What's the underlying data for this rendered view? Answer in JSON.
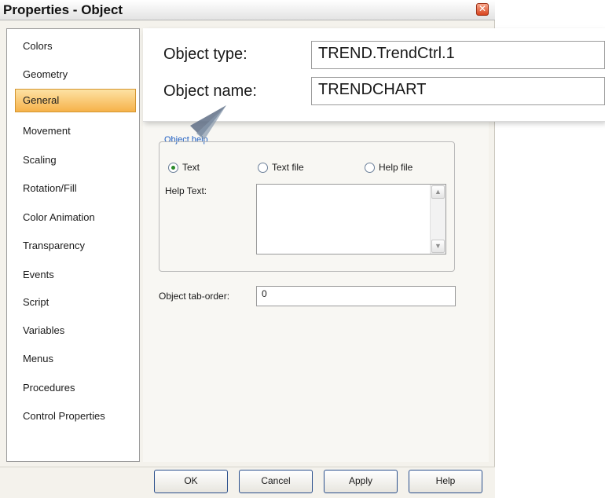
{
  "window": {
    "title": "Properties - Object",
    "close_glyph": "✕"
  },
  "sidebar": {
    "items": [
      {
        "label": "Colors"
      },
      {
        "label": "Geometry"
      },
      {
        "label": "General",
        "active": true
      },
      {
        "label": "Movement"
      },
      {
        "label": "Scaling"
      },
      {
        "label": "Rotation/Fill"
      },
      {
        "label": "Color Animation"
      },
      {
        "label": "Transparency"
      },
      {
        "label": "Events"
      },
      {
        "label": "Script"
      },
      {
        "label": "Variables"
      },
      {
        "label": "Menus"
      },
      {
        "label": "Procedures"
      },
      {
        "label": "Control Properties"
      }
    ]
  },
  "callout": {
    "object_type_label": "Object type:",
    "object_type_value": "TREND.TrendCtrl.1",
    "object_name_label": "Object name:",
    "object_name_value": "TRENDCHART"
  },
  "object_help": {
    "legend": "Object help",
    "radios": [
      {
        "label": "Text",
        "checked": true
      },
      {
        "label": "Text file",
        "checked": false
      },
      {
        "label": "Help file",
        "checked": false
      }
    ],
    "help_text_label": "Help Text:",
    "help_text_value": ""
  },
  "tab_order": {
    "label": "Object tab-order:",
    "value": "0"
  },
  "buttons": {
    "ok": "OK",
    "cancel": "Cancel",
    "apply": "Apply",
    "help": "Help"
  },
  "colors": {
    "active_item": "#f6b24a",
    "legend_text": "#1f5fc2",
    "button_border": "#2a4f8c"
  }
}
